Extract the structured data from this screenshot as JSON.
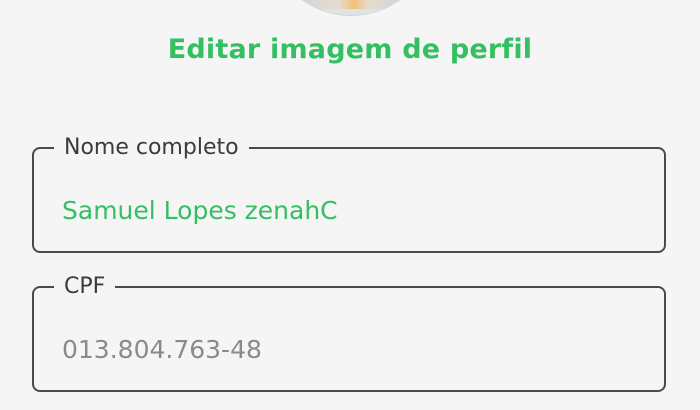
{
  "profile": {
    "edit_image_label": "Editar imagem de perfil"
  },
  "form": {
    "full_name": {
      "label": "Nome completo",
      "value": "Samuel Lopes zenahC"
    },
    "cpf": {
      "label": "CPF",
      "value": "013.804.763-48"
    }
  },
  "colors": {
    "accent": "#34bf62",
    "border": "#4a4a4a",
    "background": "#f5f5f5",
    "muted_text": "#8a8a8a"
  }
}
